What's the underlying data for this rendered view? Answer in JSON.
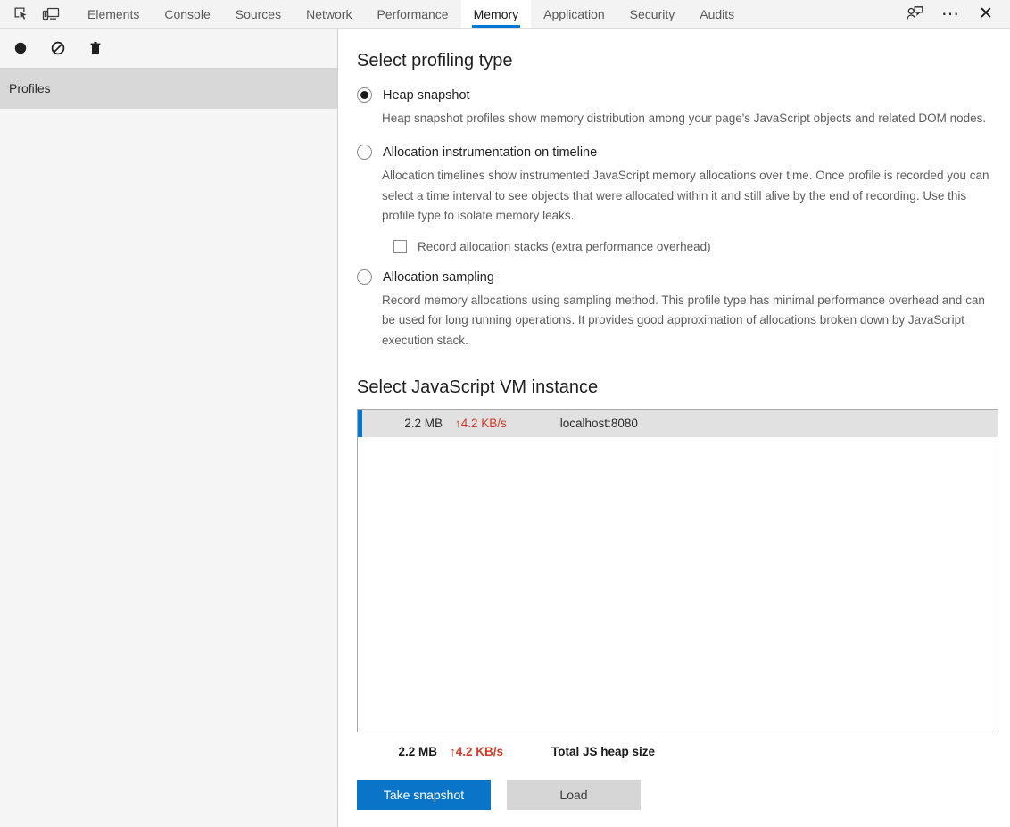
{
  "window": {
    "left_icons": [
      {
        "name": "inspect-element-icon",
        "title": "Inspect element"
      },
      {
        "name": "device-toolbar-icon",
        "title": "Toggle device toolbar"
      }
    ],
    "right_icons": [
      {
        "name": "feedback-icon",
        "title": "Send feedback"
      },
      {
        "name": "more-options-icon",
        "title": "More options",
        "glyph": "⋯"
      },
      {
        "name": "close-icon",
        "title": "Close DevTools",
        "glyph": "✕"
      }
    ],
    "accent_color": "#0078d7"
  },
  "tabs": [
    {
      "label": "Elements",
      "active": false
    },
    {
      "label": "Console",
      "active": false
    },
    {
      "label": "Sources",
      "active": false
    },
    {
      "label": "Network",
      "active": false
    },
    {
      "label": "Performance",
      "active": false
    },
    {
      "label": "Memory",
      "active": true
    },
    {
      "label": "Application",
      "active": false
    },
    {
      "label": "Security",
      "active": false
    },
    {
      "label": "Audits",
      "active": false
    }
  ],
  "sidebar": {
    "toolbar_icons": [
      {
        "name": "record-icon",
        "title": "Start recording"
      },
      {
        "name": "clear-icon",
        "title": "Stop / clear"
      },
      {
        "name": "trash-icon",
        "title": "Delete profile"
      }
    ],
    "section_label": "Profiles"
  },
  "main": {
    "profiling_heading": "Select profiling type",
    "profiling_options": [
      {
        "label": "Heap snapshot",
        "selected": true,
        "description": "Heap snapshot profiles show memory distribution among your page's JavaScript objects and related DOM nodes."
      },
      {
        "label": "Allocation instrumentation on timeline",
        "selected": false,
        "description": "Allocation timelines show instrumented JavaScript memory allocations over time. Once profile is recorded you can select a time interval to see objects that were allocated within it and still alive by the end of recording. Use this profile type to isolate memory leaks."
      },
      {
        "label": "Allocation sampling",
        "selected": false,
        "description": "Record memory allocations using sampling method. This profile type has minimal performance overhead and can be used for long running operations. It provides good approximation of allocations broken down by JavaScript execution stack."
      }
    ],
    "record_stacks_checkbox": {
      "label": "Record allocation stacks (extra performance overhead)",
      "checked": false
    },
    "vm_heading": "Select JavaScript VM instance",
    "vm_rows": [
      {
        "size": "2.2 MB",
        "rate": "↑4.2 KB/s",
        "url": "localhost:8080",
        "selected": true
      }
    ],
    "summary": {
      "size": "2.2 MB",
      "rate": "↑4.2 KB/s",
      "label": "Total JS heap size"
    },
    "buttons": {
      "primary": "Take snapshot",
      "secondary": "Load"
    },
    "rate_color": "#d13b28"
  }
}
